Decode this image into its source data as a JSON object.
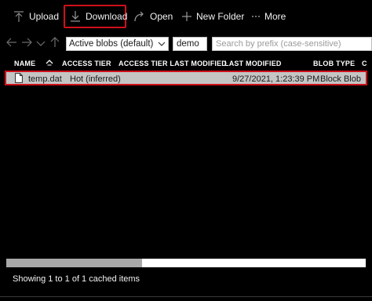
{
  "toolbar": {
    "upload_label": "Upload",
    "download_label": "Download",
    "open_label": "Open",
    "new_folder_label": "New Folder",
    "more_label": "More"
  },
  "nav": {
    "view_select": "Active blobs (default)",
    "path_value": "demo",
    "search_placeholder": "Search by prefix (case-sensitive)"
  },
  "columns": {
    "name": "NAME",
    "access_tier": "ACCESS TIER",
    "access_tier_last_modified": "ACCESS TIER LAST MODIFIED",
    "last_modified": "LAST MODIFIED",
    "blob_type": "BLOB TYPE",
    "content_type": "C"
  },
  "rows": [
    {
      "name": "temp.dat",
      "access_tier": "Hot (inferred)",
      "access_tier_last_modified": "",
      "last_modified": "9/27/2021, 1:23:39 PM",
      "blob_type": "Block Blob"
    }
  ],
  "status": {
    "text": "Showing 1 to 1 of 1 cached items"
  },
  "icons": {
    "upload": "upload-icon",
    "download": "download-icon",
    "open": "open-icon",
    "new_folder": "plus-icon",
    "more": "more-icon",
    "back": "arrow-left-icon",
    "forward": "arrow-right-icon",
    "recent": "chevron-down-icon",
    "up": "arrow-up-icon",
    "file": "file-icon"
  },
  "colors": {
    "highlight": "#d0101a",
    "selected_row": "#c5c5c5"
  }
}
